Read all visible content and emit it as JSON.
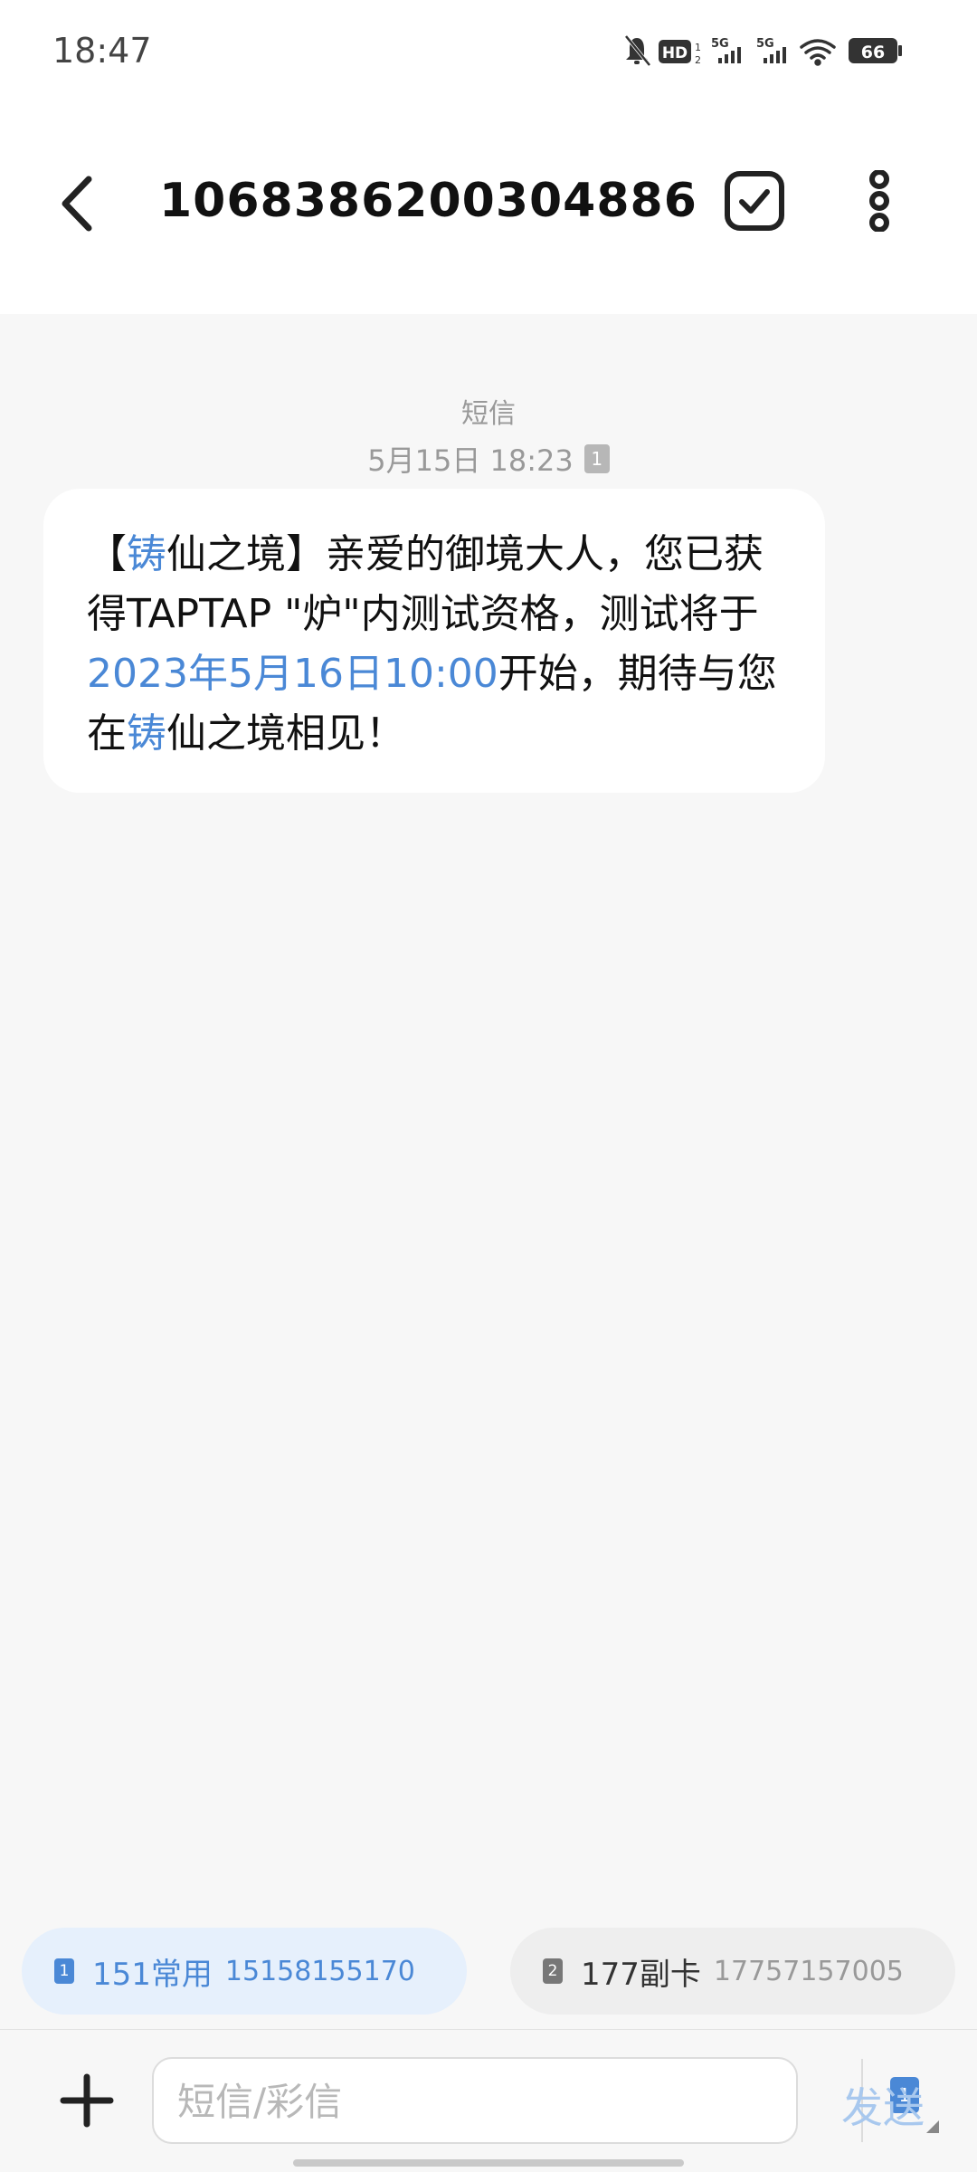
{
  "status": {
    "time": "18:47",
    "battery": "66",
    "hd_label": "HD",
    "net1": "5G",
    "net2": "5G"
  },
  "header": {
    "title": "1068386200304886"
  },
  "message": {
    "type_label": "短信",
    "timestamp": "5月15日 18:23",
    "sim_badge": "1",
    "segments": [
      {
        "text": "【",
        "hl": false
      },
      {
        "text": "铸",
        "hl": true
      },
      {
        "text": "仙之境】亲爱的御境大人，您已获得TAPTAP \"炉\"内测试资格，测试将于",
        "hl": false
      },
      {
        "text": "2023年5月16日10:00",
        "hl": true
      },
      {
        "text": "开始，期待与您在",
        "hl": false
      },
      {
        "text": "铸",
        "hl": true
      },
      {
        "text": "仙之境相见！",
        "hl": false
      }
    ]
  },
  "sims": [
    {
      "badge": "1",
      "name": "151常用",
      "number": "15158155170"
    },
    {
      "badge": "2",
      "name": "177副卡",
      "number": "17757157005"
    }
  ],
  "compose": {
    "placeholder": "短信/彩信",
    "sim_badge": "1",
    "send_label": "发送"
  },
  "colors": {
    "accent": "#4a88d6",
    "send_disabled": "#a8c8ee"
  }
}
